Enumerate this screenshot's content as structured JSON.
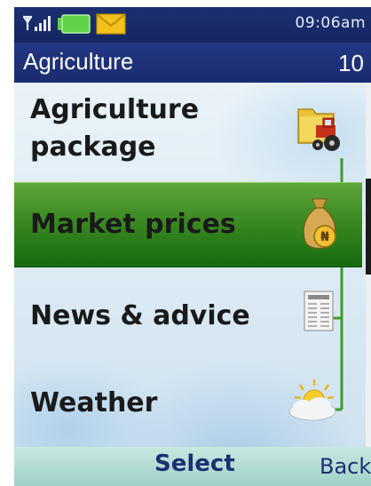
{
  "status": {
    "time": "09:06am",
    "icons": [
      "signal-icon",
      "battery-icon",
      "message-envelope-icon"
    ]
  },
  "title": {
    "app_name": "Agriculture",
    "counter": "10"
  },
  "menu": {
    "items": [
      {
        "line1": "Agriculture",
        "line2": "package",
        "icon": "tractor-folder-icon",
        "selected": false
      },
      {
        "line1": "Market prices",
        "icon": "money-bag-naira-icon",
        "selected": true
      },
      {
        "line1": "News & advice",
        "icon": "newspaper-icon",
        "selected": false
      },
      {
        "line1": "Weather",
        "icon": "sun-cloud-icon",
        "selected": false
      }
    ]
  },
  "softkeys": {
    "left": "Select",
    "right": "Back"
  },
  "colors": {
    "header": "#1c2f72",
    "selected": "#3b8a22",
    "connector": "#3f9a2a"
  }
}
